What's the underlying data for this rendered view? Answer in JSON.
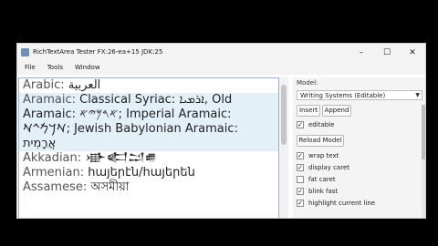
{
  "window": {
    "title": "RichTextArea Tester FX:26-ea+15  JDK:25",
    "controls": [
      "–",
      "☐",
      "✕"
    ]
  },
  "menubar": [
    "File",
    "Tools",
    "Window"
  ],
  "editor": {
    "lines": [
      {
        "label": "Arabic:",
        "text": "  العربية"
      },
      {
        "label": "Aramaic:",
        "text": "  Classical Syriac: ܐܪܡܝܐ, Old"
      },
      {
        "label": "",
        "text": "Aramaic: 𐤀𐤓𐤌𐤉𐤀; Imperial Aramaic:"
      },
      {
        "label": "",
        "text": "𐡀𐡓𐡌𐡉𐡀; Jewish Babylonian Aramaic:"
      },
      {
        "label": "",
        "text": "אֲרָמִית"
      },
      {
        "label": "Akkadian:",
        "text": "  𒀝𒅗𒁺𒌑"
      },
      {
        "label": "Armenian:",
        "text": "  հայերէն/հայերեն"
      },
      {
        "label": "Assamese:",
        "text": "  অসমীয়া"
      }
    ]
  },
  "panel": {
    "model_label": "Model:",
    "model_select": "Writing Systems (Editable)",
    "insert_button": "Insert",
    "append_button": "Append",
    "editable_label": "editable",
    "reload_button": "Reload Model",
    "options": [
      {
        "label": "wrap text",
        "checked": true
      },
      {
        "label": "display caret",
        "checked": true
      },
      {
        "label": "fat caret",
        "checked": false
      },
      {
        "label": "blink fast",
        "checked": true
      },
      {
        "label": "highlight current line",
        "checked": true
      }
    ]
  }
}
